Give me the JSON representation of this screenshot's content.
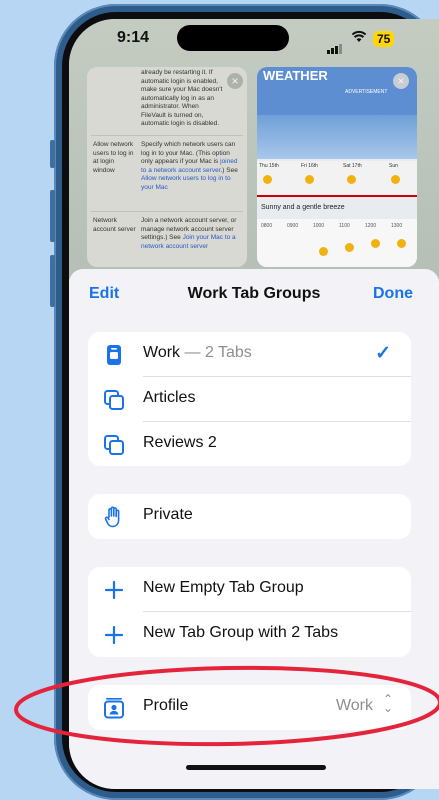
{
  "colors": {
    "accent": "#1a73e8",
    "battery": "#ffd60a",
    "annotation": "#e3243b",
    "background": "#b7d6f3"
  },
  "status_bar": {
    "time": "9:14",
    "battery": "75",
    "icons": [
      "signal-icon",
      "wifi-icon"
    ]
  },
  "background_tabs": {
    "card1": {
      "para1": "already be restarting it. If automatic login is enabled, make sure your Mac doesn't automatically log in as an administrator. When FileVault is turned on, automatic login is disabled.",
      "row2_label": "Allow network users to log in at login window",
      "row2_text": "Specify which network users can log in to your Mac. (This option only appears if your Mac is",
      "row2_link": "joined to a network account server",
      "row2_text2": ".) See",
      "row2_link2": "Allow network users to log in to your Mac",
      "row3_label": "Network account server",
      "row3_text": "Join a network account server, or manage network account server settings.) See",
      "row3_link": "Join your Mac to a network account server"
    },
    "card2": {
      "title": "WEATHER",
      "ad": "ADVERTISEMENT",
      "days": [
        "Thu 15th",
        "Fri 16th",
        "Sat 17th",
        "Sun"
      ],
      "summary": "Sunny and a gentle breeze",
      "hours": [
        "0800",
        "0900",
        "1000",
        "1100",
        "1200",
        "1300"
      ]
    }
  },
  "sheet": {
    "edit_label": "Edit",
    "title": "Work Tab Groups",
    "done_label": "Done",
    "groups": [
      {
        "rows": [
          {
            "label": "Work",
            "suffix": " — 2 Tabs",
            "icon": "phone-tab-group-icon",
            "selected": true
          },
          {
            "label": "Articles",
            "icon": "tabs-icon"
          },
          {
            "label": "Reviews 2",
            "icon": "tabs-icon"
          }
        ]
      },
      {
        "rows": [
          {
            "label": "Private",
            "icon": "hand-raised-icon"
          }
        ]
      },
      {
        "rows": [
          {
            "label": "New Empty Tab Group",
            "icon": "plus-icon"
          },
          {
            "label": "New Tab Group with 2 Tabs",
            "icon": "plus-icon"
          }
        ]
      },
      {
        "rows": [
          {
            "label": "Profile",
            "value": "Work",
            "icon": "profile-icon"
          }
        ]
      }
    ]
  }
}
